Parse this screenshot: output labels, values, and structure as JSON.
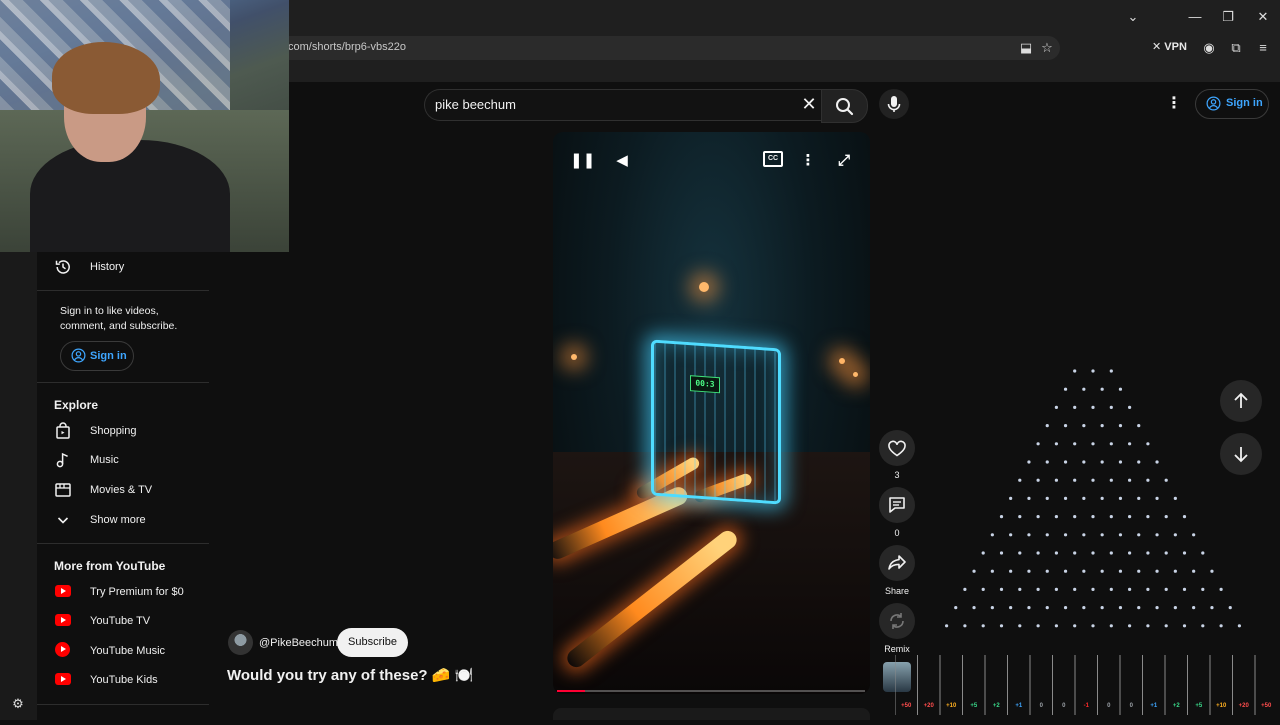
{
  "browser": {
    "url": "com/shorts/brp6-vbs22o",
    "vpn_label": "VPN"
  },
  "masthead": {
    "search_value": "pike beechum",
    "sign_in_label": "Sign in"
  },
  "sidebar": {
    "history_label": "History",
    "sign_in_message": "Sign in to like videos, comment, and subscribe.",
    "sign_in_label": "Sign in",
    "explore_heading": "Explore",
    "explore_items": [
      {
        "label": "Shopping",
        "icon": "shopping-bag-icon"
      },
      {
        "label": "Music",
        "icon": "music-note-icon"
      },
      {
        "label": "Movies & TV",
        "icon": "film-icon"
      },
      {
        "label": "Show more",
        "icon": "chevron-down-icon"
      }
    ],
    "more_heading": "More from YouTube",
    "more_items": [
      {
        "label": "Try Premium for $0",
        "icon": "youtube-premium-icon"
      },
      {
        "label": "YouTube TV",
        "icon": "youtube-tv-icon"
      },
      {
        "label": "YouTube Music",
        "icon": "youtube-music-icon"
      },
      {
        "label": "YouTube Kids",
        "icon": "youtube-kids-icon"
      }
    ]
  },
  "short": {
    "channel": "@PikeBeechum",
    "subscribe_label": "Subscribe",
    "title": "Would you try any of these? 🧀 🍽️",
    "likes": "3",
    "comments": "0",
    "share_label": "Share",
    "remix_label": "Remix",
    "cart_display": "00:3",
    "progress": 0.09
  },
  "plinko": {
    "slot_values": [
      "+50",
      "+20",
      "+10",
      "+5",
      "+2",
      "+1",
      "0",
      "0",
      "-1",
      "0",
      "0",
      "+1",
      "+2",
      "+5",
      "+10",
      "+20",
      "+50"
    ],
    "colors": {
      "high": "#ff4d4d",
      "mid": "#ffb020",
      "low": "#39d98a",
      "zero": "#9aa0a6",
      "neg": "#ff2a2a",
      "blue": "#3ea6ff"
    }
  },
  "colors": {
    "accent": "#3ea6ff",
    "youtube_red": "#ff0000",
    "background": "#0f0f0f"
  }
}
